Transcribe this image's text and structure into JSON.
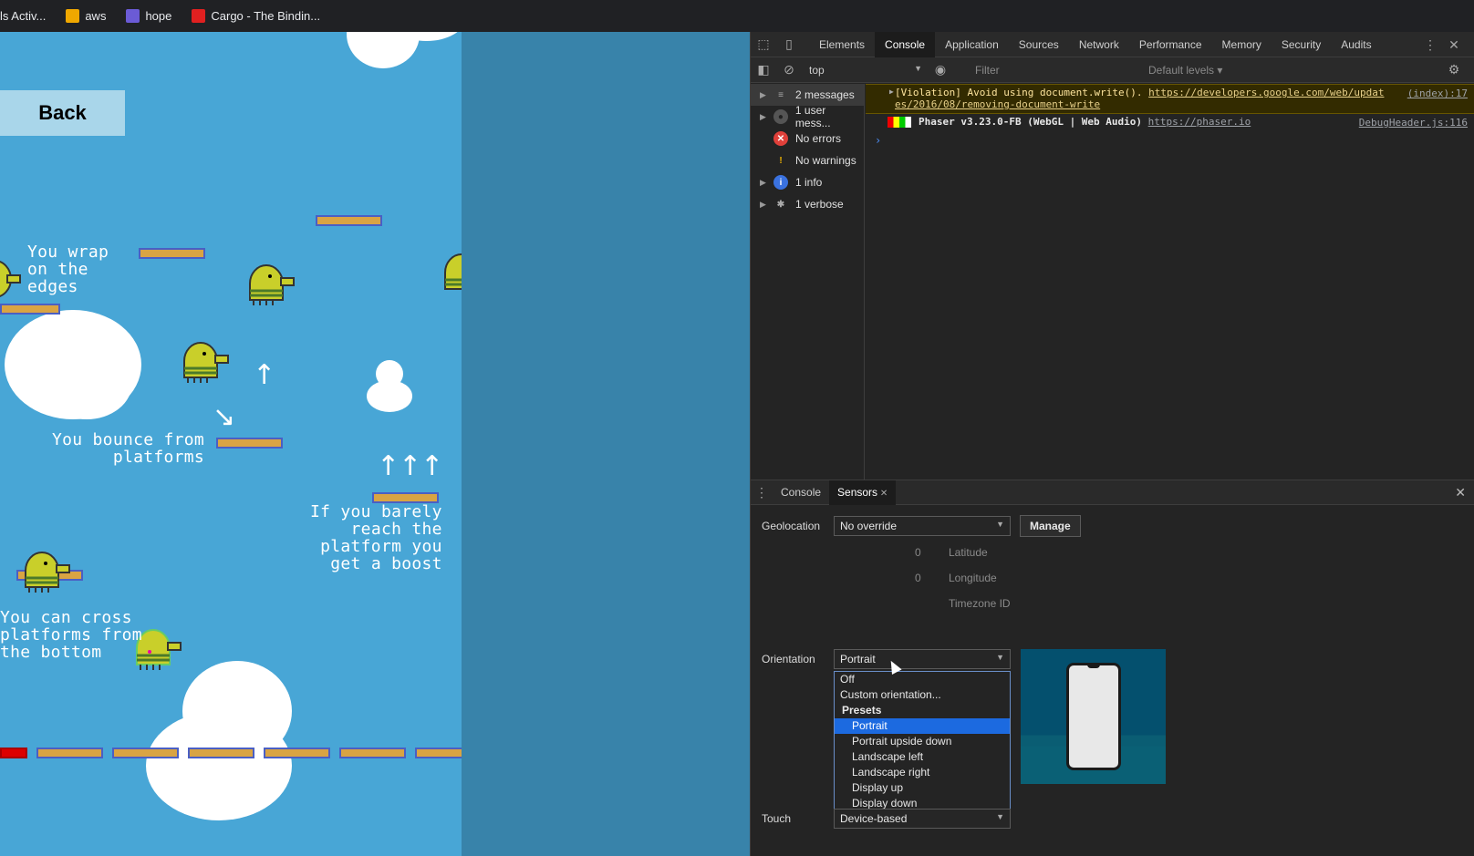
{
  "bookmarks": [
    {
      "label": "ls Activ...",
      "color": "#202124"
    },
    {
      "label": "aws",
      "color": "#f0a800"
    },
    {
      "label": "hope",
      "color": "#6b5bd6"
    },
    {
      "label": "Cargo - The Bindin...",
      "color": "#e02020"
    }
  ],
  "game": {
    "back_label": "Back",
    "text_wrap": "You wrap\non the\nedges",
    "text_bounce": "You bounce from\nplatforms",
    "text_boost": "If you barely\nreach the\nplatform you\nget a boost",
    "text_cross": "You can cross\nplatforms from\nthe bottom"
  },
  "devtools": {
    "tabs": [
      "Elements",
      "Console",
      "Application",
      "Sources",
      "Network",
      "Performance",
      "Memory",
      "Security",
      "Audits"
    ],
    "active_tab": "Console",
    "context": "top",
    "filter_placeholder": "Filter",
    "levels_label": "Default levels ▾",
    "sidebar": [
      {
        "label": "2 messages",
        "icon": "list-icon",
        "expandable": true,
        "selected": true
      },
      {
        "label": "1 user mess...",
        "icon": "user-icon",
        "expandable": true,
        "selected": false
      },
      {
        "label": "No errors",
        "icon": "error-icon",
        "expandable": false,
        "selected": false
      },
      {
        "label": "No warnings",
        "icon": "warning-icon",
        "expandable": false,
        "selected": false
      },
      {
        "label": "1 info",
        "icon": "info-icon",
        "expandable": true,
        "selected": false
      },
      {
        "label": "1 verbose",
        "icon": "bug-icon",
        "expandable": true,
        "selected": false
      }
    ],
    "messages": {
      "violation_text": "[Violation] Avoid using document.write().",
      "violation_link": "https://developers.google.com/web/updat",
      "violation_link2": "es/2016/08/removing-document-write",
      "violation_src": "(index):17",
      "phaser_text": "Phaser v3.23.0-FB (WebGL | Web Audio)",
      "phaser_link": "https://phaser.io",
      "phaser_src": "DebugHeader.js:116"
    },
    "drawer": {
      "tabs": [
        "Console",
        "Sensors"
      ],
      "active_tab": "Sensors",
      "geolocation_label": "Geolocation",
      "geolocation_value": "No override",
      "manage_label": "Manage",
      "latitude_value": "0",
      "latitude_label": "Latitude",
      "longitude_value": "0",
      "longitude_label": "Longitude",
      "timezone_label": "Timezone ID",
      "orientation_label": "Orientation",
      "orientation_value": "Portrait",
      "orientation_options": [
        {
          "label": "Off",
          "kind": "option"
        },
        {
          "label": "Custom orientation...",
          "kind": "option"
        },
        {
          "label": "Presets",
          "kind": "group"
        },
        {
          "label": "Portrait",
          "kind": "preset",
          "selected": true
        },
        {
          "label": "Portrait upside down",
          "kind": "preset"
        },
        {
          "label": "Landscape left",
          "kind": "preset"
        },
        {
          "label": "Landscape right",
          "kind": "preset"
        },
        {
          "label": "Display up",
          "kind": "preset"
        },
        {
          "label": "Display down",
          "kind": "preset"
        }
      ],
      "touch_label": "Touch",
      "touch_value": "Device-based"
    }
  },
  "colors": {
    "game_sky": "#48a6d6",
    "platform": "#d9a443",
    "platform_border": "#4a5fc4",
    "selected_option": "#1c6ae0"
  }
}
